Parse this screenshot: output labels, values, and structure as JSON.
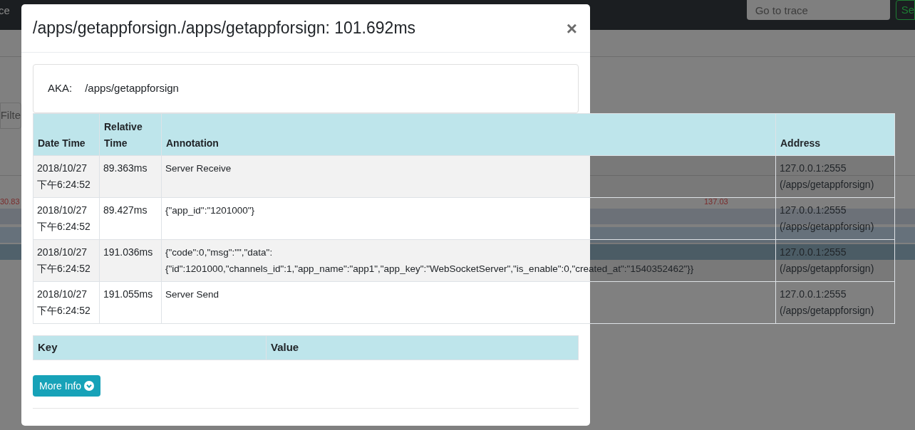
{
  "nav": {
    "items": [
      "ce"
    ],
    "go_to_trace": {
      "placeholder": "Go to trace"
    },
    "search_button": "Se"
  },
  "background": {
    "filter_label": "Filte",
    "timeline_labels": [
      "30.83",
      "137.03"
    ]
  },
  "modal": {
    "title": "/apps/getappforsign./apps/getappforsign: 101.692ms",
    "close": "×",
    "aka_label": "AKA:",
    "aka_value": "/apps/getappforsign",
    "annotations": {
      "columns": [
        "Date Time",
        "Relative Time",
        "Annotation",
        "Address"
      ],
      "rows": [
        {
          "date_time": "2018/10/27 下午6:24:52",
          "relative_time": "89.363ms",
          "annotation": "Server Receive",
          "address": "127.0.0.1:2555 (/apps/getappforsign)"
        },
        {
          "date_time": "2018/10/27 下午6:24:52",
          "relative_time": "89.427ms",
          "annotation": "{\"app_id\":\"1201000\"}",
          "address": "127.0.0.1:2555 (/apps/getappforsign)"
        },
        {
          "date_time": "2018/10/27 下午6:24:52",
          "relative_time": "191.036ms",
          "annotation": "{\"code\":0,\"msg\":\"\",\"data\": {\"id\":1201000,\"channels_id\":1,\"app_name\":\"app1\",\"app_key\":\"WebSocketServer\",\"is_enable\":0,\"created_at\":\"1540352462\"}}",
          "address": "127.0.0.1:2555 (/apps/getappforsign)"
        },
        {
          "date_time": "2018/10/27 下午6:24:52",
          "relative_time": "191.055ms",
          "annotation": "Server Send",
          "address": "127.0.0.1:2555 (/apps/getappforsign)"
        }
      ]
    },
    "binary_annotations": {
      "columns": [
        "Key",
        "Value"
      ]
    },
    "more_info_button": "More Info"
  }
}
